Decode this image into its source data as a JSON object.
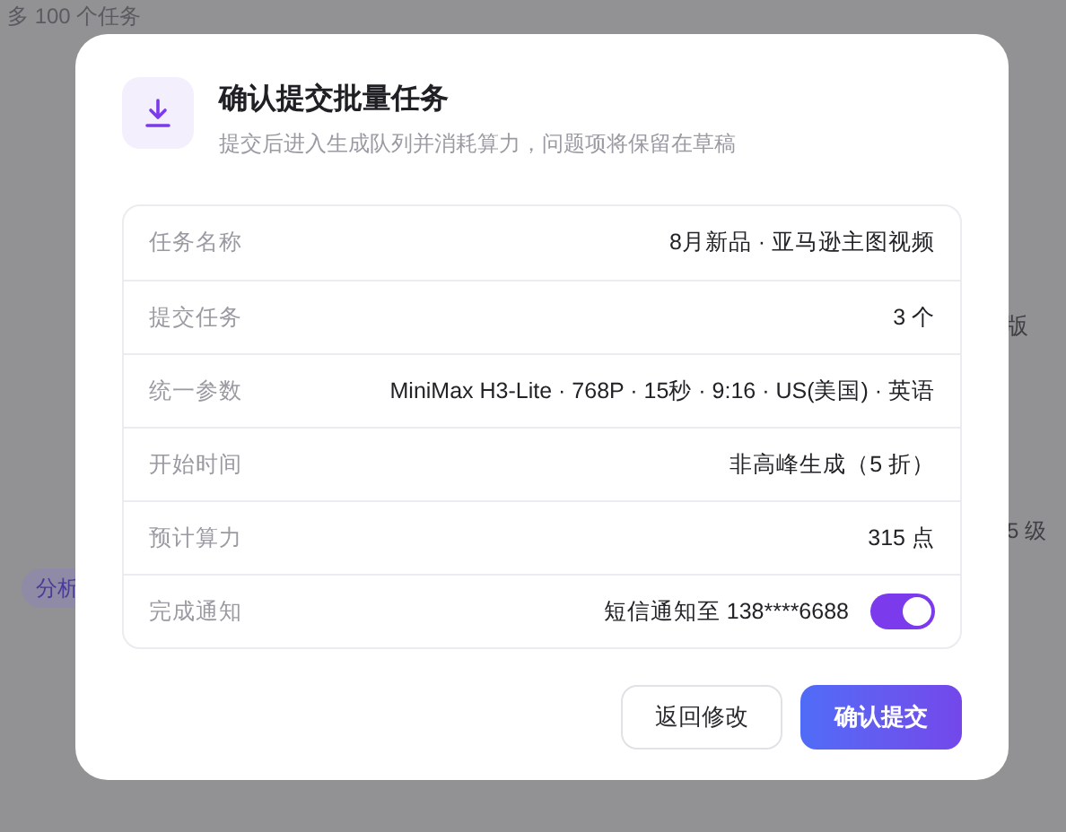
{
  "background": {
    "hint": "多 100 个任务",
    "tag": "分析",
    "fragment_1": "版",
    "fragment_2": "5 级"
  },
  "dialog": {
    "title": "确认提交批量任务",
    "subtitle": "提交后进入生成队列并消耗算力，问题项将保留在草稿",
    "rows": [
      {
        "label": "任务名称",
        "value": "8月新品 · 亚马逊主图视频",
        "kind": "text"
      },
      {
        "label": "提交任务",
        "value": "3 个",
        "kind": "text"
      },
      {
        "label": "统一参数",
        "value": "MiniMax H3-Lite · 768P · 15秒 · 9:16 · US(美国) · 英语",
        "kind": "text"
      },
      {
        "label": "开始时间",
        "value": "非高峰生成（5 折）",
        "kind": "text"
      },
      {
        "label": "预计算力",
        "value": "315 点",
        "kind": "text"
      },
      {
        "label": "完成通知",
        "value": "短信通知至 138****6688",
        "kind": "toggle",
        "on": true
      }
    ],
    "buttons": [
      {
        "label": "返回修改",
        "kind": "secondary"
      },
      {
        "label": "确认提交",
        "kind": "primary"
      }
    ]
  }
}
